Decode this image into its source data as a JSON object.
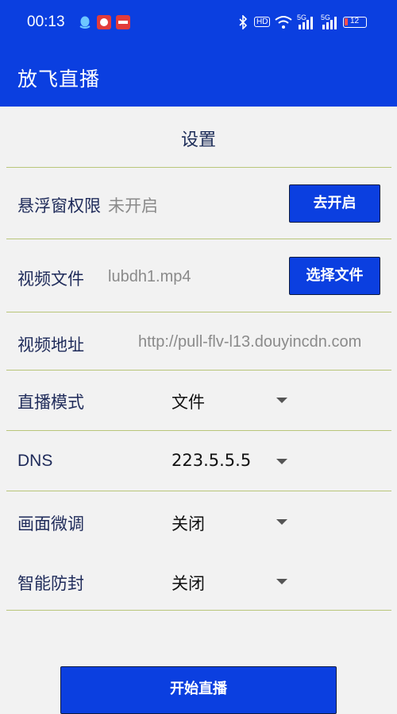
{
  "status_bar": {
    "time": "00:13",
    "hd_badge": "HD",
    "net1": "5G",
    "net2": "5G",
    "battery": "12"
  },
  "app_bar": {
    "title": "放飞直播"
  },
  "settings": {
    "title": "设置",
    "overlay_permission": {
      "label": "悬浮窗权限",
      "status": "未开启",
      "button": "去开启"
    },
    "video_file": {
      "label": "视频文件",
      "value": "lubdh1.mp4",
      "button": "选择文件"
    },
    "video_url": {
      "label": "视频地址",
      "value": "http://pull-flv-l13.douyincdn.com"
    },
    "live_mode": {
      "label": "直播模式",
      "selected": "文件"
    },
    "dns": {
      "label": "DNS",
      "selected": "223.5.5.5"
    },
    "fine_tune": {
      "label": "画面微调",
      "selected": "关闭"
    },
    "anti_ban": {
      "label": "智能防封",
      "selected": "关闭"
    }
  },
  "start_button": "开始直播",
  "colors": {
    "primary": "#0b3fe0",
    "divider": "#b9c67a",
    "label": "#1f2b5a"
  }
}
